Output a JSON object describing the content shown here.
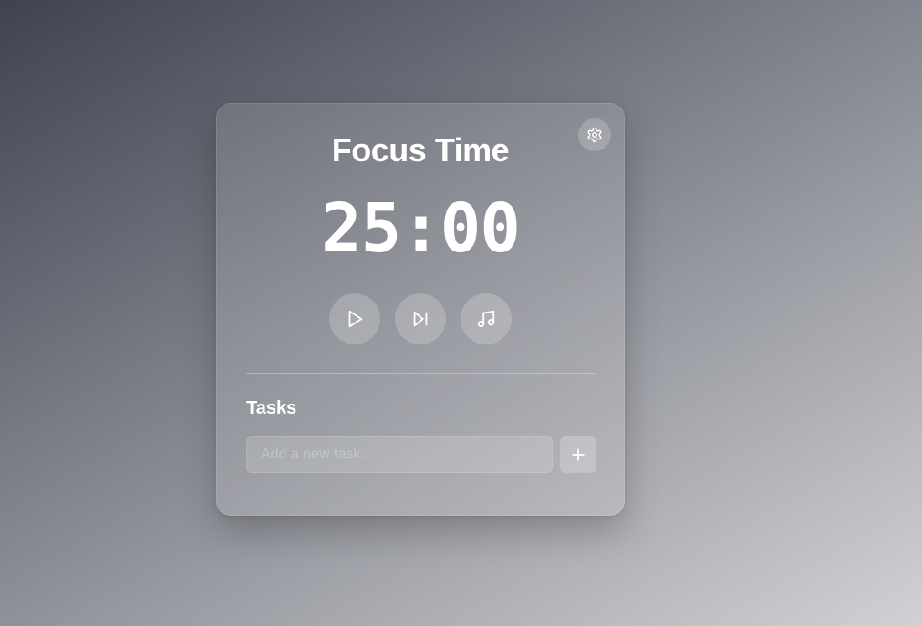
{
  "card": {
    "title": "Focus Time",
    "timer": "25:00"
  },
  "controls": {
    "settings_icon": "gear-icon",
    "play_icon": "play-icon",
    "skip_icon": "skip-forward-icon",
    "music_icon": "music-note-icon"
  },
  "tasks": {
    "heading": "Tasks",
    "input_placeholder": "Add a new task...",
    "input_value": "",
    "add_icon": "plus-icon"
  },
  "colors": {
    "text": "#ffffff",
    "background_start": "#3f4350",
    "background_end": "#d0d1d4"
  }
}
